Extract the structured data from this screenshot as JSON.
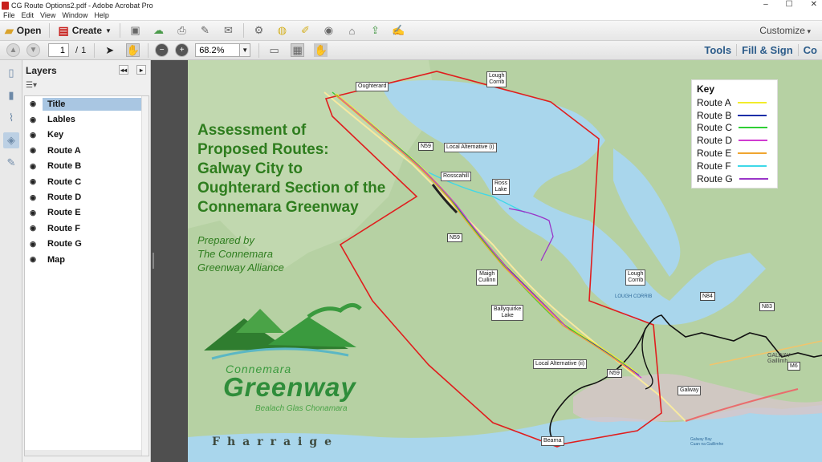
{
  "window": {
    "title": "CG Route Options2.pdf - Adobe Acrobat Pro"
  },
  "menu": [
    "File",
    "Edit",
    "View",
    "Window",
    "Help"
  ],
  "toolbar": {
    "open_label": "Open",
    "create_label": "Create",
    "customize_label": "Customize"
  },
  "nav": {
    "page_current": "1",
    "page_sep": "/",
    "page_total": "1",
    "zoom": "68.2%"
  },
  "right_links": [
    "Tools",
    "Fill & Sign",
    "Co"
  ],
  "layers_panel": {
    "title": "Layers",
    "layers": [
      {
        "name": "Title",
        "selected": true
      },
      {
        "name": "Lables"
      },
      {
        "name": "Key"
      },
      {
        "name": "Route A"
      },
      {
        "name": "Route B"
      },
      {
        "name": "Route C"
      },
      {
        "name": "Route D"
      },
      {
        "name": "Route E"
      },
      {
        "name": "Route F"
      },
      {
        "name": "Route G"
      },
      {
        "name": "Map"
      }
    ]
  },
  "document": {
    "title_lines": [
      "Assessment of",
      "Proposed Routes:",
      "Galway City to",
      "Oughterard Section of the",
      "Connemara Greenway"
    ],
    "subtitle_lines": [
      "Prepared by",
      "The Connemara",
      "Greenway Alliance"
    ],
    "logo": {
      "name": "Connemara",
      "main": "Greenway",
      "tagline": "Bealach Glas Chonamara"
    },
    "sea_label": "Fharraige",
    "key": {
      "title": "Key",
      "items": [
        {
          "label": "Route A",
          "color": "#f2ec2a"
        },
        {
          "label": "Route B",
          "color": "#1a2fa8"
        },
        {
          "label": "Route C",
          "color": "#2fcf35"
        },
        {
          "label": "Route D",
          "color": "#d03bd0"
        },
        {
          "label": "Route E",
          "color": "#f0a530"
        },
        {
          "label": "Route F",
          "color": "#3fd8e8"
        },
        {
          "label": "Route G",
          "color": "#9a35c8"
        }
      ]
    },
    "map_labels": {
      "oughterard": "Oughterard",
      "lough_corrib_top": [
        "Lough",
        "Corrib"
      ],
      "local_alt_1": "Local Alternative (i)",
      "rosscahill": "Rosscahill",
      "ross_lake": [
        "Ross",
        "Lake"
      ],
      "lough_corrib_mid": [
        "Lough",
        "Corrib"
      ],
      "maigh_cuilinn": [
        "Maigh",
        "Cuilinn"
      ],
      "ballyquirke": [
        "Ballyquirke",
        "Lake"
      ],
      "local_alt_2": "Local Alternative (ii)",
      "galway": "Galway",
      "bearna": "Bearna",
      "lough_corrib_water": "LOUGH CORRIB",
      "galway_city": "GALWAY\nGaillimh",
      "galway_bay": "Galway Bay\nCuan na Gaillimhe"
    },
    "road_labels": {
      "n59_a": "N59",
      "n59_b": "N59",
      "n59_c": "N59",
      "n84": "N84",
      "n83": "N83",
      "m6": "M6"
    }
  }
}
